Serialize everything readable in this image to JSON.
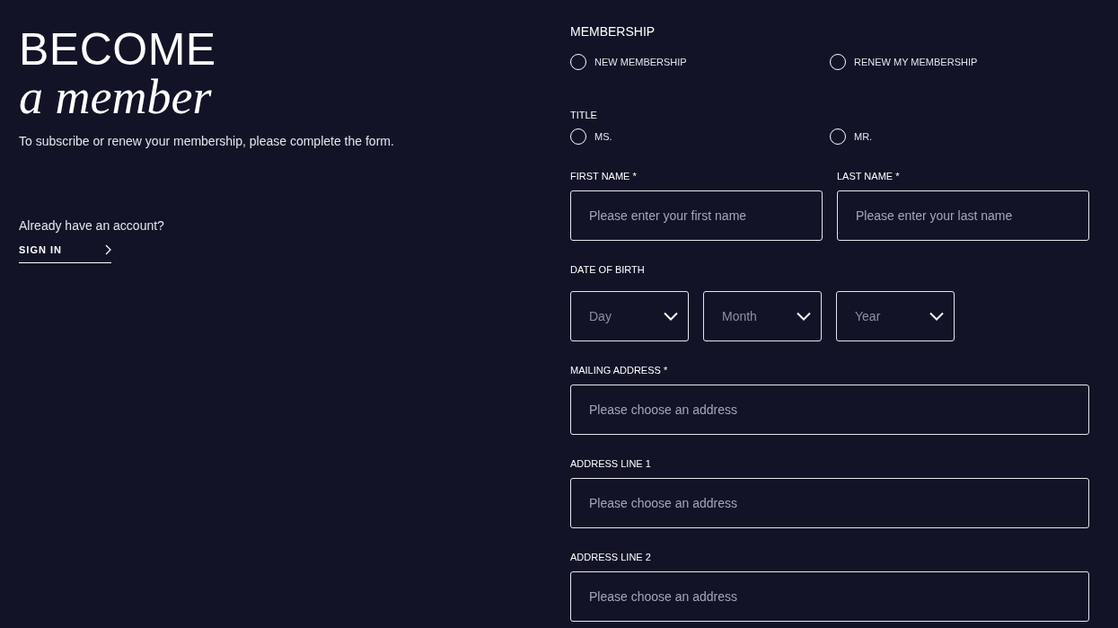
{
  "intro": {
    "title_line1": "BECOME",
    "title_line2": "a member",
    "subtitle": "To subscribe or renew your membership, please complete the form."
  },
  "account": {
    "prompt": "Already have an account?",
    "sign_in": "SIGN IN"
  },
  "membership": {
    "label": "MEMBERSHIP",
    "options": [
      {
        "label": "NEW MEMBERSHIP",
        "selected": false
      },
      {
        "label": "RENEW MY MEMBERSHIP",
        "selected": false
      }
    ]
  },
  "title": {
    "label": "TITLE",
    "options": [
      {
        "label": "MS.",
        "selected": false
      },
      {
        "label": "MR.",
        "selected": false
      }
    ]
  },
  "name_fields": [
    {
      "label": "FIRST NAME *",
      "placeholder": "Please enter your first name"
    },
    {
      "label": "LAST NAME *",
      "placeholder": "Please enter your last name"
    }
  ],
  "date_of_birth": {
    "label": "DATE OF BIRTH",
    "selects": [
      {
        "placeholder": "Day"
      },
      {
        "placeholder": "Month"
      },
      {
        "placeholder": "Year"
      }
    ]
  },
  "address_fields": [
    {
      "label": "MAILING ADDRESS *",
      "placeholder": "Please choose an address"
    },
    {
      "label": "ADDRESS LINE 1",
      "placeholder": "Please choose an address"
    },
    {
      "label": "ADDRESS LINE 2",
      "placeholder": "Please choose an address"
    }
  ]
}
